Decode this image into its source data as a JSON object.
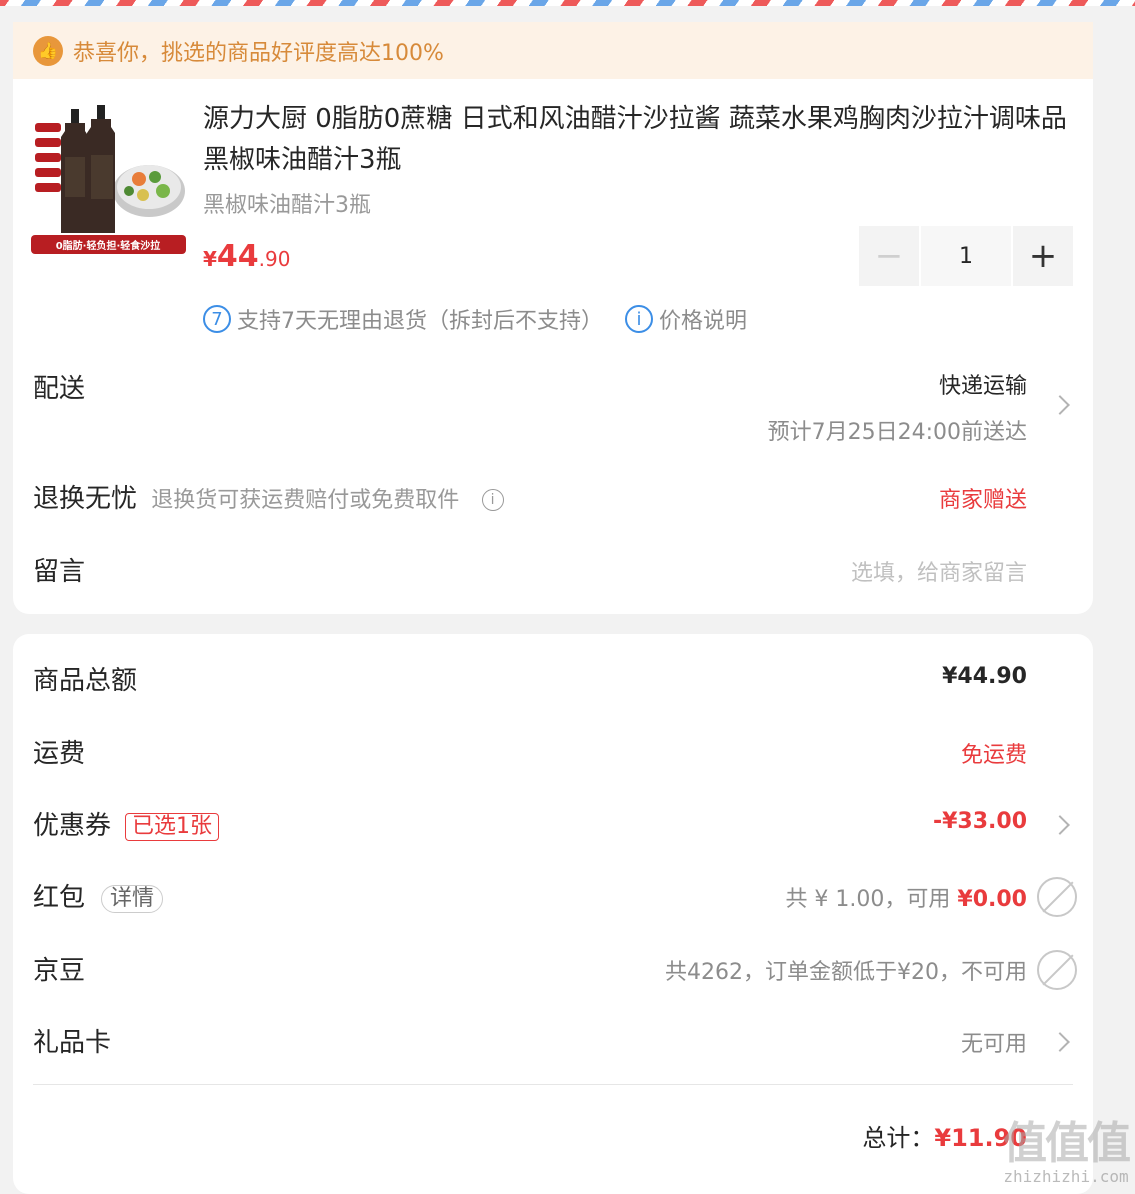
{
  "congrats": {
    "text": "恭喜你，挑选的商品好评度高达100%"
  },
  "product": {
    "image_texts": [
      "0脂肪·轻负担·轻食沙拉"
    ],
    "title": "源力大厨 0脂肪0蔗糖 日式和风油醋汁沙拉酱 蔬菜水果鸡胸肉沙拉汁调味品 黑椒味油醋汁3瓶",
    "spec": "黑椒味油醋汁3瓶",
    "price_currency": "¥",
    "price_int": "44",
    "price_dec": ".90",
    "quantity": "1",
    "minus": "−",
    "plus": "+",
    "return_policy_badge": "7",
    "return_policy": "支持7天无理由退货（拆封后不支持）",
    "price_note_badge": "i",
    "price_note": "价格说明"
  },
  "delivery": {
    "label": "配送",
    "method": "快递运输",
    "eta": "预计7月25日24:00前送达"
  },
  "worry_free": {
    "label": "退换无忧",
    "desc": "退换货可获运费赔付或免费取件",
    "info": "i",
    "value": "商家赠送"
  },
  "message": {
    "label": "留言",
    "placeholder": "选填，给商家留言"
  },
  "summary": {
    "goods_total_label": "商品总额",
    "goods_total": "¥44.90",
    "shipping_label": "运费",
    "shipping": "免运费",
    "coupon_label": "优惠券",
    "coupon_tag": "已选1张",
    "coupon_value": "-¥33.00",
    "redpacket_label": "红包",
    "redpacket_tag": "详情",
    "redpacket_prefix": "共 ¥ 1.00，可用 ",
    "redpacket_usable": "¥0.00",
    "jingdou_label": "京豆",
    "jingdou_value": "共4262，订单金额低于¥20，不可用",
    "giftcard_label": "礼品卡",
    "giftcard_value": "无可用",
    "total_label": "总计：",
    "total": "¥11.90"
  },
  "watermark": {
    "logo": "值",
    "url": "zhizhizhi.com"
  },
  "colors": {
    "accent_red": "#e93b3d",
    "orange": "#d78a3a",
    "blue": "#3c8ee6"
  }
}
